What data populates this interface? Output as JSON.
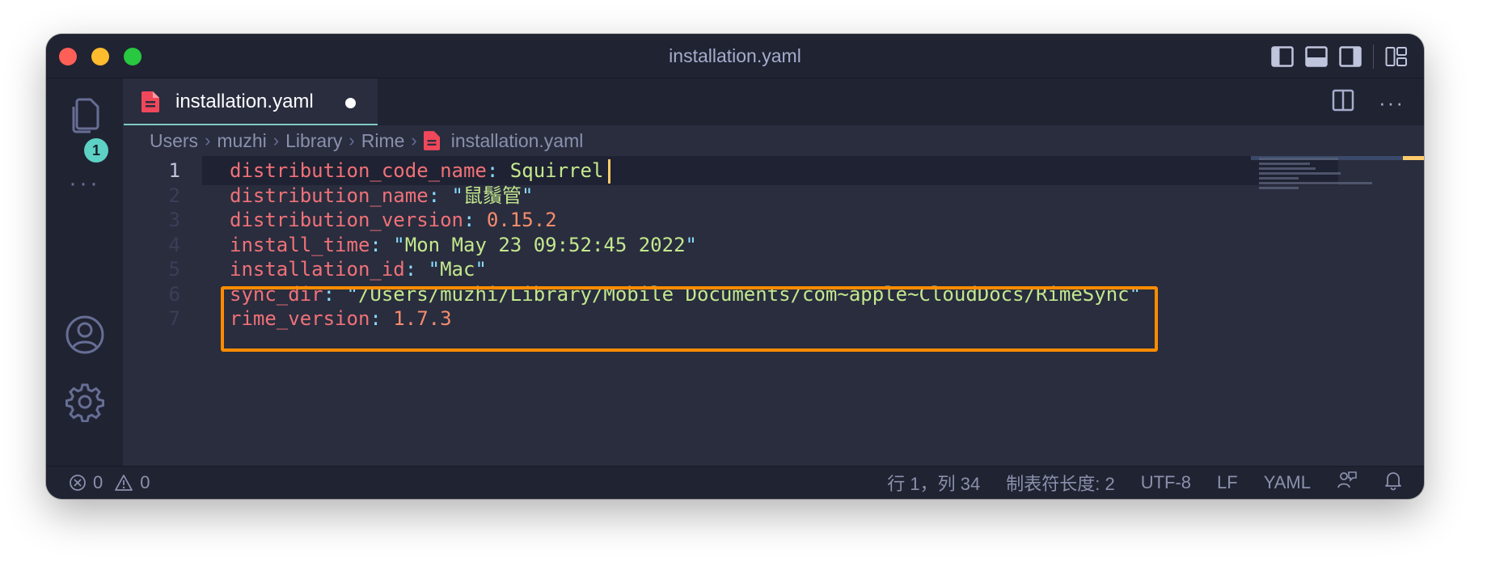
{
  "window": {
    "title": "installation.yaml"
  },
  "activity_bar": {
    "explorer_badge": "1"
  },
  "tab": {
    "label": "installation.yaml"
  },
  "breadcrumb": [
    "Users",
    "muzhi",
    "Library",
    "Rime",
    "installation.yaml"
  ],
  "editor": {
    "lines": [
      {
        "num": "1",
        "key": "distribution_code_name",
        "value": "Squirrel",
        "value_type": "plain"
      },
      {
        "num": "2",
        "key": "distribution_name",
        "value": "鼠鬚管",
        "value_type": "string"
      },
      {
        "num": "3",
        "key": "distribution_version",
        "value": "0.15.2",
        "value_type": "number"
      },
      {
        "num": "4",
        "key": "install_time",
        "value": "Mon May 23 09:52:45 2022",
        "value_type": "string"
      },
      {
        "num": "5",
        "key": "installation_id",
        "value": "Mac",
        "value_type": "string"
      },
      {
        "num": "6",
        "key": "sync_dir",
        "value": "/Users/muzhi/Library/Mobile Documents/com~apple~CloudDocs/RimeSync",
        "value_type": "string"
      },
      {
        "num": "7",
        "key": "rime_version",
        "value": "1.7.3",
        "value_type": "number"
      }
    ]
  },
  "statusbar": {
    "errors": "0",
    "warnings": "0",
    "position": "行 1，列 34",
    "tab_size": "制表符长度: 2",
    "encoding": "UTF-8",
    "eol": "LF",
    "language": "YAML"
  },
  "colors": {
    "highlight_box": "#ff8c00",
    "accent": "#80cbc4",
    "badge": "#5cd1c4"
  }
}
